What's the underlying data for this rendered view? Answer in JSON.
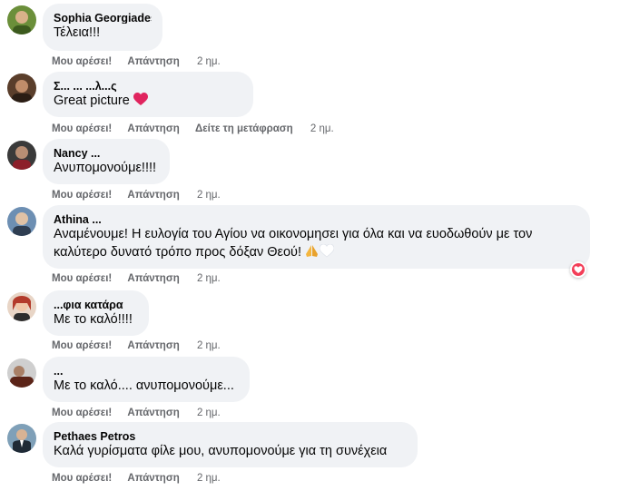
{
  "labels": {
    "like": "Μου αρέσει!",
    "reply": "Απάντηση",
    "translate": "Δείτε τη μετάφραση"
  },
  "colors": {
    "bubble": "#f0f2f5",
    "secondary_text": "#65676b",
    "heart": "#f33e58"
  },
  "comments": [
    {
      "author": "Sophia Georgiades",
      "text": "Τέλεια!!!",
      "time": "2 ημ.",
      "avatar_icon": "user-avatar-icon"
    },
    {
      "author": "Σ... ... ...λ...ς",
      "text": "Great picture",
      "emoji": "heart-icon",
      "time": "2 ημ.",
      "avatar_icon": "user-avatar-icon"
    },
    {
      "author": "Nancy ...",
      "text": "Ανυπομονούμε!!!!",
      "time": "2 ημ.",
      "avatar_icon": "user-avatar-icon"
    },
    {
      "author": "Athina ...",
      "text": "Αναμένουμε! Η ευλογία του Αγίου να οικονομησει για όλα και να ευοδωθούν με τον καλύτερο δυνατό τρόπο προς δόξαν Θεού!",
      "emoji": "praying-hands-icon, white-heart-icon",
      "reaction": "love-reaction-icon",
      "time": "2 ημ.",
      "avatar_icon": "user-avatar-icon"
    },
    {
      "author": "...φια κατάρα",
      "text": "Με το καλό!!!!",
      "time": "2 ημ.",
      "avatar_icon": "user-avatar-icon"
    },
    {
      "author": "...",
      "text": "Με το καλό.... ανυπομονούμε...",
      "time": "2 ημ.",
      "avatar_icon": "user-avatar-icon"
    },
    {
      "author": "Pethaes Petros",
      "text": "Καλά γυρίσματα φίλε μου, ανυπομονούμε για τη συνέχεια",
      "time": "2 ημ.",
      "avatar_icon": "user-avatar-icon"
    }
  ]
}
